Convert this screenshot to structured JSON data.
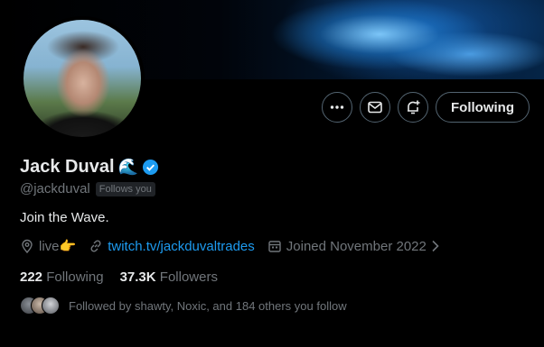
{
  "profile": {
    "display_name": "Jack Duval",
    "name_emoji": "🌊",
    "handle": "@jackduval",
    "follows_you_badge": "Follows you",
    "bio": "Join the Wave.",
    "location": "live👉",
    "website": "twitch.tv/jackduvaltrades",
    "joined": "Joined November 2022",
    "verified_color": "#1d9bf0"
  },
  "actions": {
    "more_icon": "ellipsis-icon",
    "message_icon": "mail-icon",
    "notify_icon": "bell-plus-icon",
    "following_label": "Following"
  },
  "stats": {
    "following_count": "222",
    "following_label": "Following",
    "followers_count": "37.3K",
    "followers_label": "Followers"
  },
  "followed_by": {
    "text": "Followed by shawty, Noxic, and 184 others you follow"
  },
  "colors": {
    "background": "#000000",
    "text": "#e7e9ea",
    "muted": "#71767b",
    "accent": "#1d9bf0",
    "border": "#536471"
  }
}
